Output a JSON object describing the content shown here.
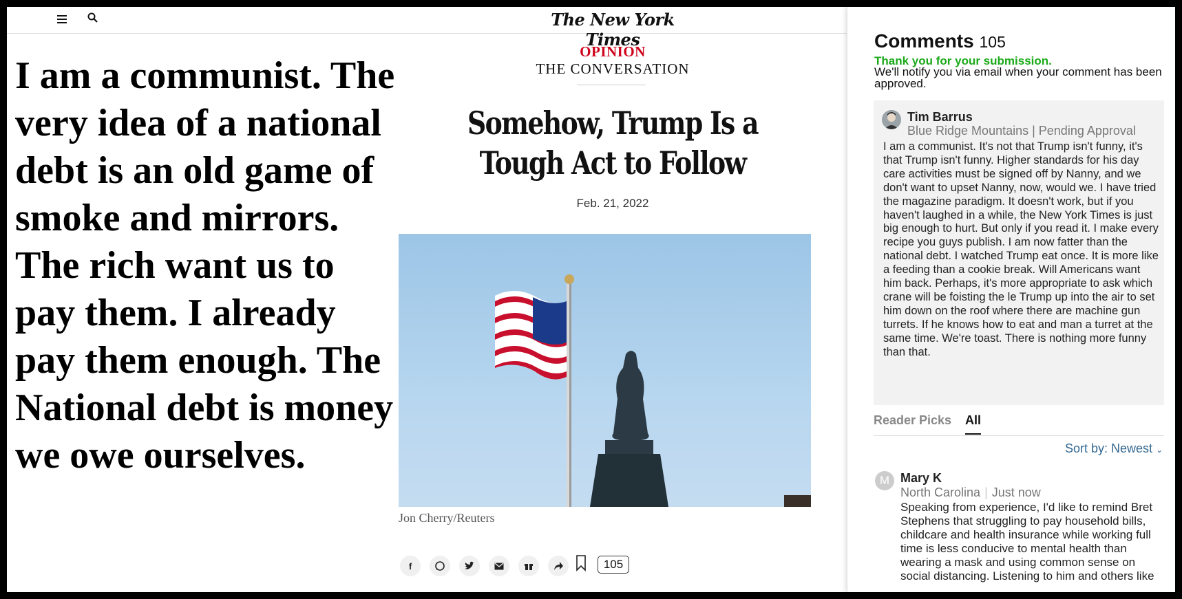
{
  "header": {
    "logo": "The New York Times",
    "menu_icon": "menu-icon",
    "search_icon": "search-icon"
  },
  "overlay_quote": "I am a communist. The very idea of a national debt is an old game of smoke and mirrors. The rich want us to pay them. I already pay them enough. The National debt is money we owe ourselves.",
  "article": {
    "kicker": "OPINION",
    "series": "THE CONVERSATION",
    "headline": "Somehow, Trump Is a Tough Act to Follow",
    "date": "Feb. 21, 2022",
    "photo_credit": "Jon Cherry/Reuters",
    "share_icons": [
      "facebook-icon",
      "whatsapp-icon",
      "twitter-icon",
      "email-icon",
      "gift-icon",
      "share-icon",
      "bookmark-icon"
    ],
    "comment_count": "105"
  },
  "comments": {
    "title": "Comments",
    "count": "105",
    "submission_thanks": "Thank you for your submission.",
    "submission_notice": "We'll notify you via email when your comment has been approved.",
    "pending": {
      "name": "Tim Barrus",
      "location": "Blue Ridge Mountains",
      "status": "Pending Approval",
      "meta": "Blue Ridge Mountains | Pending Approval",
      "body": "I am a communist. It's not that Trump isn't funny, it's that Trump isn't funny. Higher standards for his day care activities must be signed off by Nanny, and we don't want to upset Nanny, now, would we. I have tried the magazine paradigm. It doesn't work, but if you haven't laughed in a while, the New York Times is just big enough to hurt. But only if you read it. I make every recipe you guys publish. I am now fatter than the national debt. I watched Trump eat once. It is more like a feeding than a cookie break. Will Americans want him back. Perhaps, it's more appropriate to ask which crane will be foisting the le Trump up into the air to set him down on the roof where there are machine gun turrets. If he knows how to eat and man a turret at the same time. We're toast. There is nothing more funny than that."
    },
    "tabs": [
      "Reader Picks",
      "All"
    ],
    "active_tab": "All",
    "sort_label": "Sort by: Newest",
    "first": {
      "initial": "M",
      "name": "Mary K",
      "location": "North Carolina",
      "time": "Just now",
      "body": "Speaking from experience, I'd like to remind Bret Stephens that struggling to pay household bills, childcare and health insurance while working full time is less conducive to mental health than wearing a mask and using common sense on social distancing. Listening to him and others like"
    }
  },
  "colors": {
    "opinion_red": "#d0021b",
    "success_green": "#1aaa18",
    "link_blue": "#326891",
    "pending_bg": "#f2f2f2"
  }
}
